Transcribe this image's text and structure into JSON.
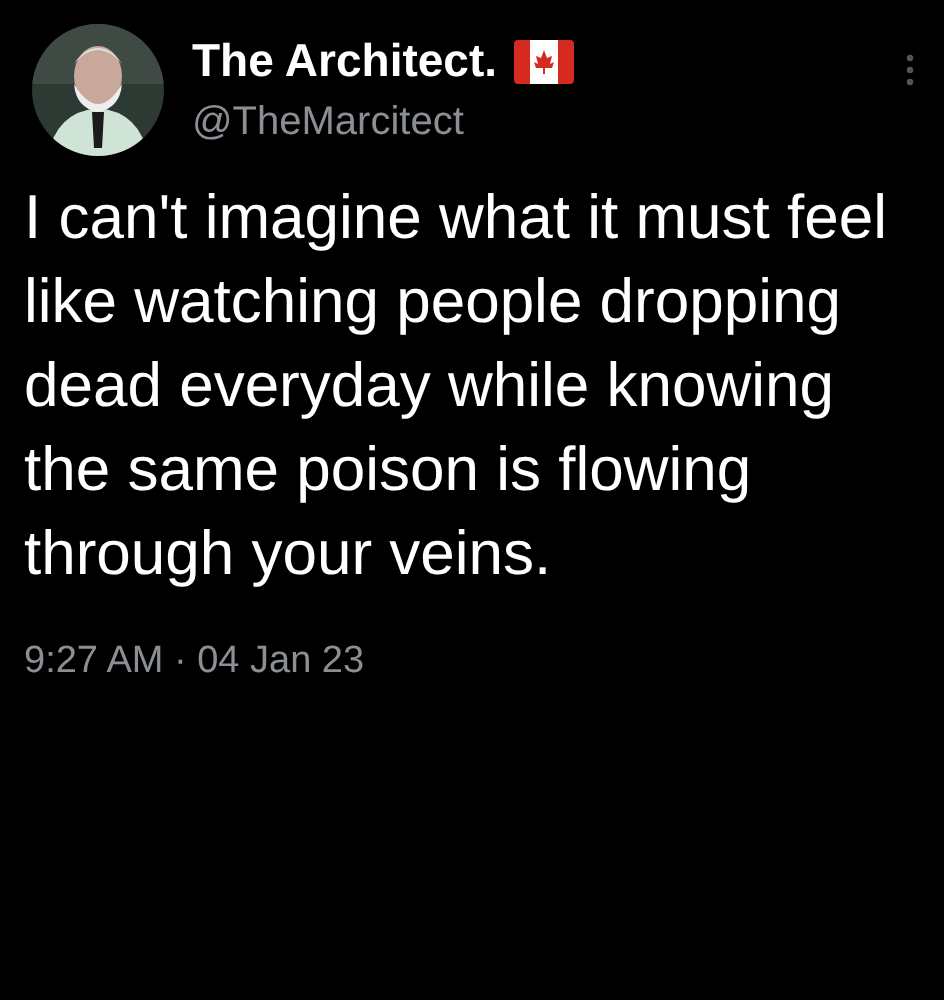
{
  "author": {
    "name": "The Architect.",
    "handle": "@TheMarcitect"
  },
  "body": "I can't imagine what it must feel like watching people dropping dead everyday while knowing the same poison is flowing through your veins.",
  "timestamp": "9:27 AM · 04 Jan 23"
}
